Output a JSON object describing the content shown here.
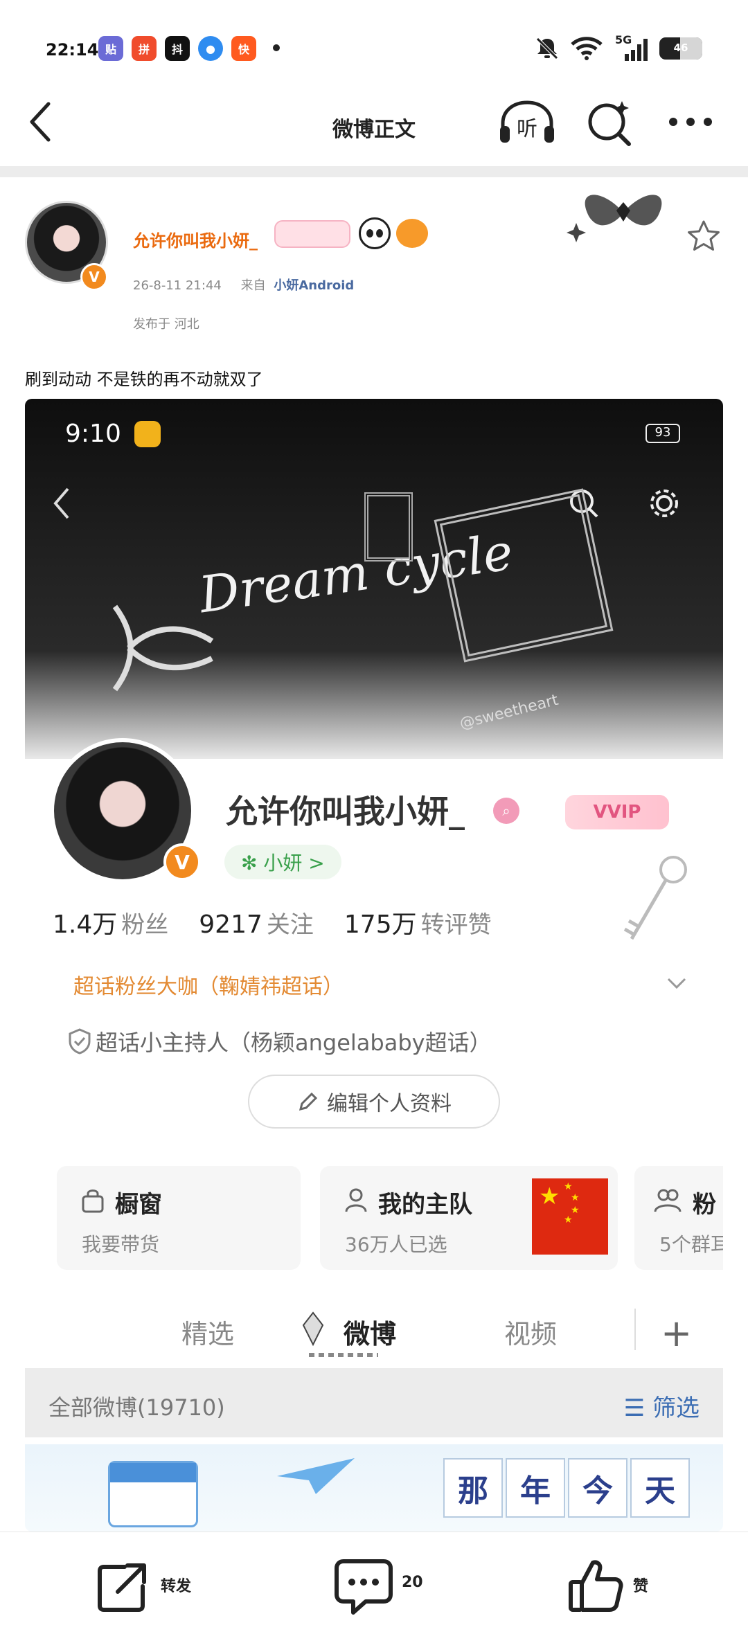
{
  "status_bar": {
    "time": "22:14",
    "app_icons": [
      "贴",
      "拼",
      "抖",
      "●",
      "快"
    ],
    "network": "5G",
    "battery": "46"
  },
  "nav": {
    "title": "微博正文"
  },
  "post": {
    "author": "允许你叫我小妍_",
    "datetime": "26-8-11 21:44",
    "source_prefix": "来自",
    "source": "小妍Android",
    "location": "发布于 河北",
    "text": "刷到动动 不是铁的再不动就双了"
  },
  "shot": {
    "status_time": "9:10",
    "battery": "93",
    "banner_text": "Dream cycle",
    "watermark": "@sweetheart",
    "name": "允许你叫我小妍_",
    "vvip": "VVIP",
    "tag": "✻ 小妍 >",
    "stats": [
      {
        "value": "1.4万",
        "label": "粉丝"
      },
      {
        "value": "9217",
        "label": "关注"
      },
      {
        "value": "175万",
        "label": "转评赞"
      }
    ],
    "honor1": "超话粉丝大咖（鞠婧祎超话）",
    "honor2": "超话小主持人（杨颖angelababy超话）",
    "edit_profile": "编辑个人资料",
    "cards": [
      {
        "title": "橱窗",
        "sub": "我要带货"
      },
      {
        "title": "我的主队",
        "sub": "36万人已选"
      },
      {
        "title": "粉",
        "sub": "5个群耳"
      }
    ],
    "tabs": [
      "精选",
      "微博",
      "视频"
    ],
    "filter_left": "全部微博(19710)",
    "filter_right": "筛选",
    "day_chars": [
      "那",
      "年",
      "今",
      "天"
    ]
  },
  "actions": {
    "repost": "转发",
    "comments": "20",
    "like": "赞"
  }
}
